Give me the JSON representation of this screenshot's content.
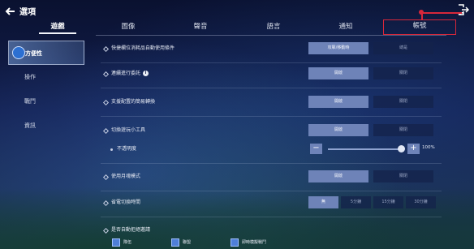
{
  "app": {
    "title": "選項"
  },
  "tabs": [
    {
      "label": "遊戲",
      "active": true
    },
    {
      "label": "圖像"
    },
    {
      "label": "聲音"
    },
    {
      "label": "語言"
    },
    {
      "label": "通知"
    },
    {
      "label": "帳號",
      "highlighted": true
    }
  ],
  "sidebar": {
    "items": [
      {
        "label": "方便性",
        "active": true
      },
      {
        "label": "操作"
      },
      {
        "label": "戰鬥"
      },
      {
        "label": "資訊"
      }
    ]
  },
  "settings": {
    "quick_slot": {
      "label": "快捷欄位消耗品自動使用條件",
      "options": [
        "攻擊/移動時",
        "總是"
      ],
      "selected": 0
    },
    "continuous": {
      "label": "連續進行委託",
      "options": [
        "開啟",
        "關閉"
      ],
      "selected": 0
    },
    "quick_switch": {
      "label": "支援配置的簡易轉換",
      "options": [
        "開啟",
        "關閉"
      ],
      "selected": 0
    },
    "mini_tool": {
      "label": "切換遊玩小工具",
      "options": [
        "開啟",
        "關閉"
      ],
      "selected": 0
    },
    "opacity": {
      "label": "不透明度",
      "minus": "−",
      "plus": "+",
      "value": "100%",
      "level": 1.0
    },
    "moon_mode": {
      "label": "使用月魂模式",
      "options": [
        "開啟",
        "關閉"
      ],
      "selected": 0
    },
    "power_save": {
      "label": "省電切換時間",
      "options": [
        "無",
        "5分鐘",
        "15分鐘",
        "30分鐘"
      ],
      "selected": 0
    },
    "auto_decline": {
      "label": "是否自動拒絕邀請",
      "checks": [
        {
          "label": "隊伍",
          "checked": true
        },
        {
          "label": "聯盟",
          "checked": true
        },
        {
          "label": "即時模擬戰鬥",
          "checked": true
        }
      ]
    }
  },
  "colors": {
    "highlight": "#d8273a",
    "accent": "#6e83b8",
    "check": "#4f7fd8"
  }
}
